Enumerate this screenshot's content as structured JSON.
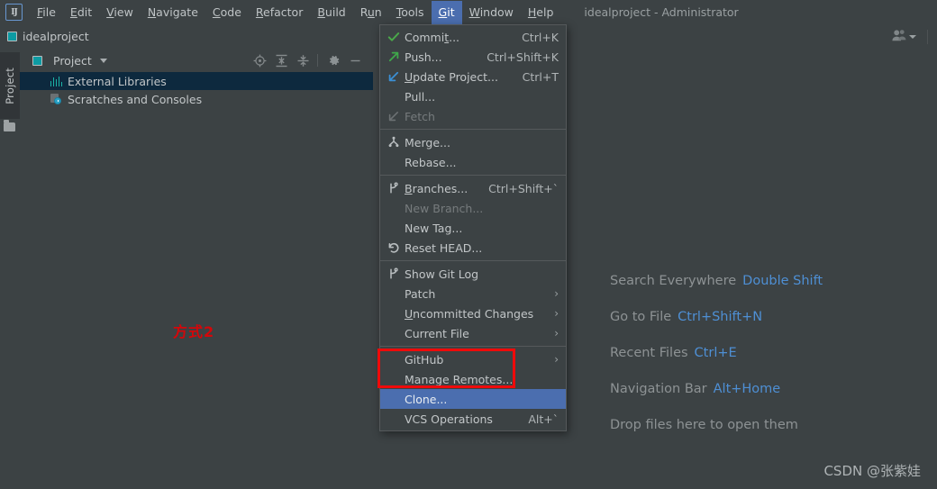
{
  "window": {
    "title": "idealproject - Administrator",
    "logo_text": "IJ"
  },
  "menubar": {
    "items": [
      {
        "label": "File",
        "accel": "F",
        "active": false
      },
      {
        "label": "Edit",
        "accel": "E",
        "active": false
      },
      {
        "label": "View",
        "accel": "V",
        "active": false
      },
      {
        "label": "Navigate",
        "accel": "N",
        "active": false
      },
      {
        "label": "Code",
        "accel": "C",
        "active": false
      },
      {
        "label": "Refactor",
        "accel": "R",
        "active": false
      },
      {
        "label": "Build",
        "accel": "B",
        "active": false
      },
      {
        "label": "Run",
        "accel": "u",
        "active": false
      },
      {
        "label": "Tools",
        "accel": "T",
        "active": false
      },
      {
        "label": "Git",
        "accel": "G",
        "active": true
      },
      {
        "label": "Window",
        "accel": "W",
        "active": false
      },
      {
        "label": "Help",
        "accel": "H",
        "active": false
      }
    ]
  },
  "navbar": {
    "project_name": "idealproject",
    "user_icon": "people-icon",
    "dropdown_icon": "chevron-down-icon"
  },
  "toolstrip": {
    "project_tab_label": "Project",
    "folder_icon": "folder-icon"
  },
  "project_panel": {
    "title": "Project",
    "caret_icon": "chevron-down-icon",
    "toolbar_icons": [
      {
        "name": "locate-target-icon"
      },
      {
        "name": "expand-all-icon"
      },
      {
        "name": "collapse-all-icon"
      },
      {
        "name": "settings-gear-icon"
      },
      {
        "name": "minimize-icon"
      }
    ],
    "tree": [
      {
        "label": "External Libraries",
        "icon": "library-bars-icon",
        "selected": true
      },
      {
        "label": "Scratches and Consoles",
        "icon": "scratches-clock-icon",
        "selected": false
      }
    ]
  },
  "git_menu": {
    "rows": [
      {
        "type": "item",
        "label": "Commit...",
        "accel": "t",
        "shortcut": "Ctrl+K",
        "icon": "check-green-icon",
        "disabled": false,
        "selected": false,
        "submenu": false
      },
      {
        "type": "item",
        "label": "Push...",
        "accel": "",
        "shortcut": "Ctrl+Shift+K",
        "icon": "arrow-up-right-green-icon",
        "disabled": false,
        "selected": false,
        "submenu": false
      },
      {
        "type": "item",
        "label": "Update Project...",
        "accel": "U",
        "shortcut": "Ctrl+T",
        "icon": "arrow-down-left-blue-icon",
        "disabled": false,
        "selected": false,
        "submenu": false
      },
      {
        "type": "item",
        "label": "Pull...",
        "accel": "",
        "shortcut": "",
        "icon": "",
        "disabled": false,
        "selected": false,
        "submenu": false
      },
      {
        "type": "item",
        "label": "Fetch",
        "accel": "",
        "shortcut": "",
        "icon": "arrow-down-left-gray-icon",
        "disabled": true,
        "selected": false,
        "submenu": false
      },
      {
        "type": "separator"
      },
      {
        "type": "item",
        "label": "Merge...",
        "accel": "",
        "shortcut": "",
        "icon": "merge-branch-icon",
        "disabled": false,
        "selected": false,
        "submenu": false
      },
      {
        "type": "item",
        "label": "Rebase...",
        "accel": "",
        "shortcut": "",
        "icon": "",
        "disabled": false,
        "selected": false,
        "submenu": false
      },
      {
        "type": "separator"
      },
      {
        "type": "item",
        "label": "Branches...",
        "accel": "B",
        "shortcut": "Ctrl+Shift+`",
        "icon": "branch-icon",
        "disabled": false,
        "selected": false,
        "submenu": false
      },
      {
        "type": "item",
        "label": "New Branch...",
        "accel": "",
        "shortcut": "",
        "icon": "",
        "disabled": true,
        "selected": false,
        "submenu": false
      },
      {
        "type": "item",
        "label": "New Tag...",
        "accel": "",
        "shortcut": "",
        "icon": "",
        "disabled": false,
        "selected": false,
        "submenu": false
      },
      {
        "type": "item",
        "label": "Reset HEAD...",
        "accel": "",
        "shortcut": "",
        "icon": "reset-undo-icon",
        "disabled": false,
        "selected": false,
        "submenu": false
      },
      {
        "type": "separator"
      },
      {
        "type": "item",
        "label": "Show Git Log",
        "accel": "",
        "shortcut": "",
        "icon": "branch-icon",
        "disabled": false,
        "selected": false,
        "submenu": false
      },
      {
        "type": "item",
        "label": "Patch",
        "accel": "",
        "shortcut": "",
        "icon": "",
        "disabled": false,
        "selected": false,
        "submenu": true
      },
      {
        "type": "item",
        "label": "Uncommitted Changes",
        "accel": "U",
        "shortcut": "",
        "icon": "",
        "disabled": false,
        "selected": false,
        "submenu": true
      },
      {
        "type": "item",
        "label": "Current File",
        "accel": "",
        "shortcut": "",
        "icon": "",
        "disabled": false,
        "selected": false,
        "submenu": true
      },
      {
        "type": "separator"
      },
      {
        "type": "item",
        "label": "GitHub",
        "accel": "",
        "shortcut": "",
        "icon": "",
        "disabled": false,
        "selected": false,
        "submenu": true
      },
      {
        "type": "item",
        "label": "Manage Remotes...",
        "accel": "",
        "shortcut": "",
        "icon": "",
        "disabled": false,
        "selected": false,
        "submenu": false
      },
      {
        "type": "item",
        "label": "Clone...",
        "accel": "",
        "shortcut": "",
        "icon": "",
        "disabled": false,
        "selected": true,
        "submenu": false
      },
      {
        "type": "item",
        "label": "VCS Operations",
        "accel": "",
        "shortcut": "Alt+`",
        "icon": "",
        "disabled": false,
        "selected": false,
        "submenu": false
      }
    ]
  },
  "editor": {
    "hints": [
      {
        "label": "Search Everywhere",
        "key": "Double Shift"
      },
      {
        "label": "Go to File",
        "key": "Ctrl+Shift+N"
      },
      {
        "label": "Recent Files",
        "key": "Ctrl+E"
      },
      {
        "label": "Navigation Bar",
        "key": "Alt+Home"
      },
      {
        "label": "Drop files here to open them",
        "key": ""
      }
    ]
  },
  "annotations": {
    "chinese_note": "方式2",
    "watermark": "CSDN @张紫娃",
    "highlight_color": "#ef0a0a",
    "selection_color": "#4b6eaf"
  }
}
